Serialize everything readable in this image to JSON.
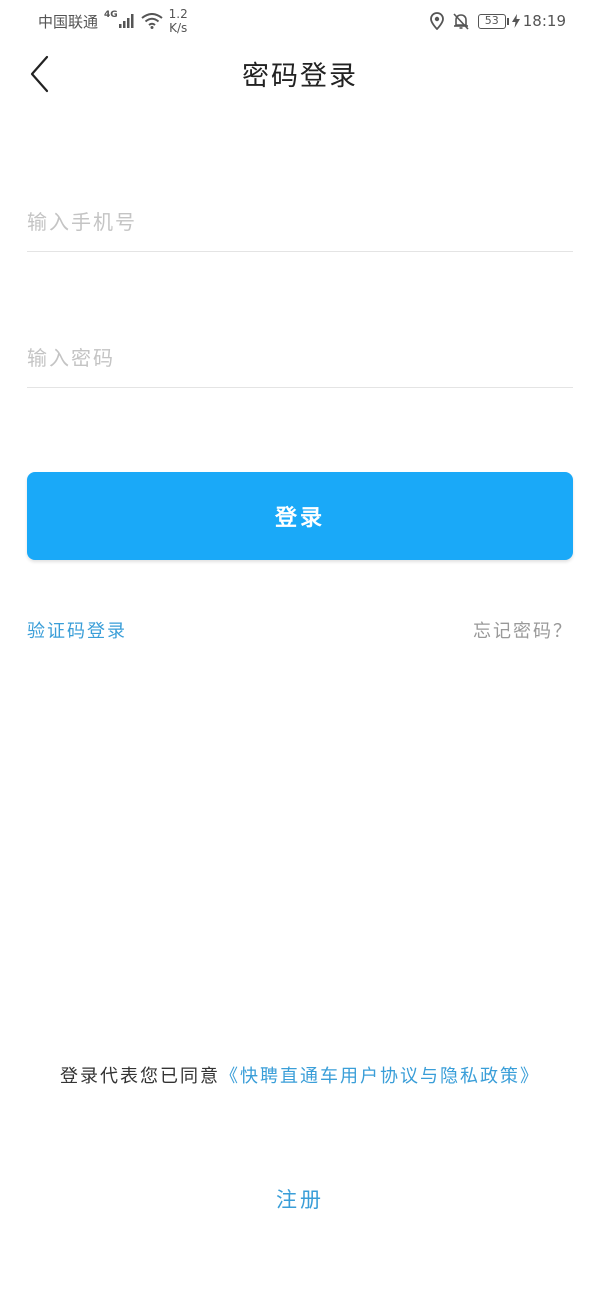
{
  "status_bar": {
    "carrier": "中国联通",
    "network_type": "4G",
    "speed_value": "1.2",
    "speed_unit": "K/s",
    "battery": "53",
    "time": "18:19"
  },
  "nav": {
    "title": "密码登录"
  },
  "form": {
    "phone_placeholder": "输入手机号",
    "phone_value": "",
    "password_placeholder": "输入密码",
    "password_value": ""
  },
  "actions": {
    "login_label": "登录",
    "sms_login_label": "验证码登录",
    "forgot_password_label": "忘记密码？"
  },
  "agreement": {
    "prefix": "登录代表您已同意",
    "link": "《快聘直通车用户协议与隐私政策》"
  },
  "register_label": "注册",
  "colors": {
    "primary": "#1aa9f8",
    "link": "#3a9ed8"
  }
}
